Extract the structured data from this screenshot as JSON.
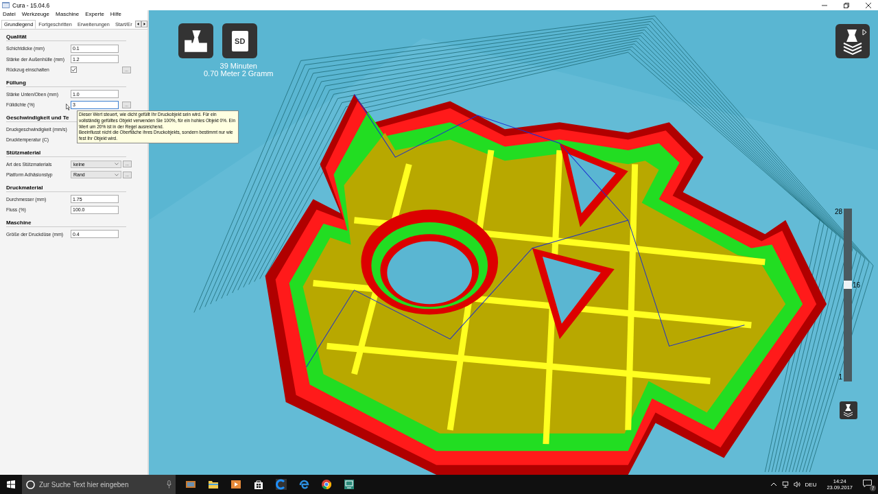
{
  "window": {
    "title": "Cura - 15.04.6"
  },
  "menu": [
    "Datei",
    "Werkzeuge",
    "Maschine",
    "Experte",
    "Hilfe"
  ],
  "tabs": [
    {
      "label": "Grundlegend",
      "selected": true
    },
    {
      "label": "Fortgeschritten",
      "selected": false
    },
    {
      "label": "Erweiterungen",
      "selected": false
    },
    {
      "label": "Start/Er",
      "selected": false
    }
  ],
  "sections": [
    {
      "title": "Qualität",
      "rows": [
        {
          "kind": "text",
          "label": "Schichtdicke (mm)",
          "value": "0.1"
        },
        {
          "kind": "text",
          "label": "Stärke der Außenhülle (mm)",
          "value": "1.2"
        },
        {
          "kind": "checkbox",
          "label": "Rückzug einschalten",
          "checked": true,
          "more": "..."
        }
      ]
    },
    {
      "title": "Füllung",
      "rows": [
        {
          "kind": "text",
          "label": "Stärke Unten/Oben (mm)",
          "value": "1.0"
        },
        {
          "kind": "text",
          "label": "Fülldichte (%)",
          "value": "3",
          "more": "...",
          "focused": true
        }
      ]
    },
    {
      "title": "Geschwindigkeit und Te",
      "rows": [
        {
          "kind": "hidden",
          "label": "Druckgeschwindigkeit (mm/s)"
        },
        {
          "kind": "hidden",
          "label": "Drucktemperatur (C)"
        }
      ]
    },
    {
      "title": "Stützmaterial",
      "rows": [
        {
          "kind": "select",
          "label": "Art des Stützmaterials",
          "value": "keine",
          "more": "..."
        },
        {
          "kind": "select",
          "label": "Platform Adhäsionstyp",
          "value": "Rand",
          "more": "..."
        }
      ]
    },
    {
      "title": "Druckmaterial",
      "rows": [
        {
          "kind": "text",
          "label": "Durchmesser (mm)",
          "value": "1.75"
        },
        {
          "kind": "text",
          "label": "Fluss (%)",
          "value": "100.0"
        }
      ]
    },
    {
      "title": "Maschine",
      "rows": [
        {
          "kind": "text",
          "label": "Größe der Druckdüse (mm)",
          "value": "0.4"
        }
      ]
    }
  ],
  "tooltip": "Dieser Wert steuert, wie dicht gefüllt Ihr Druckobjekt sein wird. Für ein vollständig gefülltes Objekt verwenden Sie 100%, für ein hohles Objekt 0%. Ein Wert um 20% ist in der Regel ausreichend.\nBeeinflusst nicht die Oberfläche ihres Druckobjekts, sondern bestimmt nur wie fest Ihr Objekt wird.",
  "print_info": {
    "time": "39 Minuten",
    "material": "0.70 Meter 2 Gramm",
    "sd_label": "SD"
  },
  "layer_slider": {
    "max": "28",
    "current": "16",
    "min": "1",
    "level": 0.56
  },
  "taskbar": {
    "search_placeholder": "Zur Suche Text hier eingeben",
    "language": "DEU",
    "time": "14:24",
    "date": "23.09.2017",
    "notifications": "7"
  }
}
